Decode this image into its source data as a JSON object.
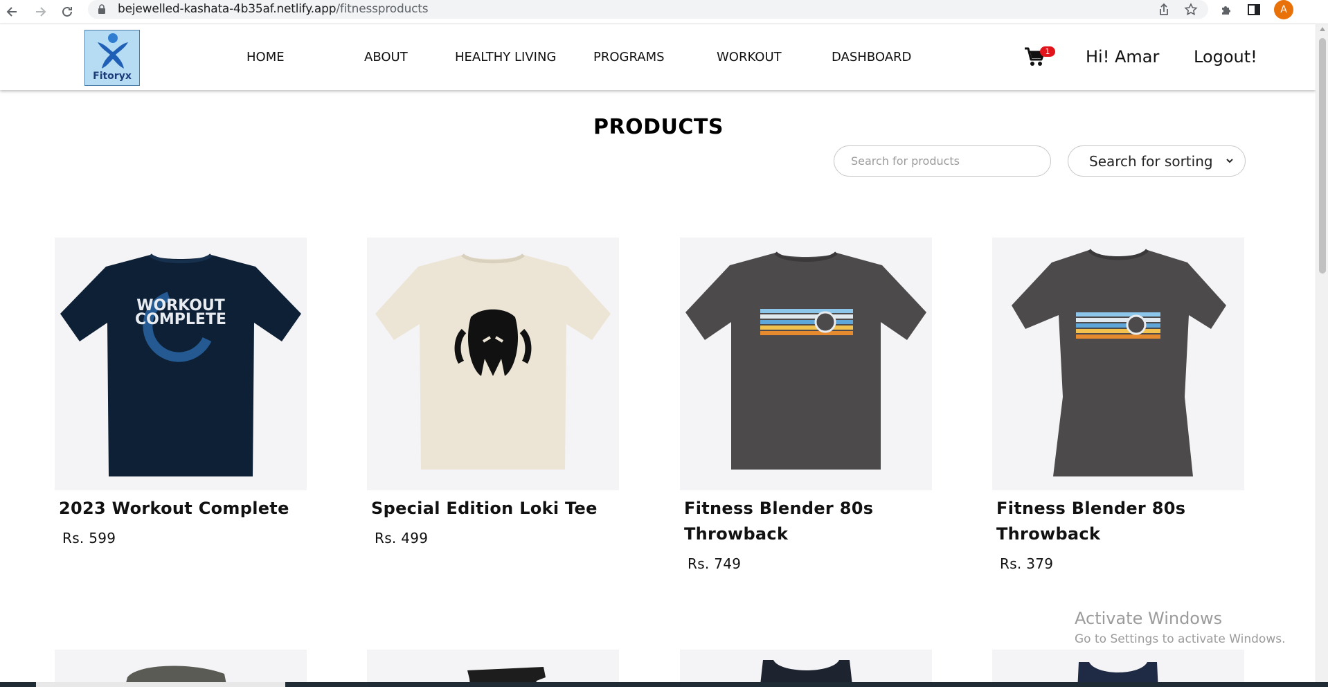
{
  "browser": {
    "url_host": "bejewelled-kashata-4b35af.netlify.app",
    "url_path": "/fitnessproducts",
    "profile_initial": "A"
  },
  "header": {
    "logo_text": "Fitoryx",
    "nav": [
      {
        "label": "HOME"
      },
      {
        "label": "ABOUT"
      },
      {
        "label": "HEALTHY LIVING"
      },
      {
        "label": "PROGRAMS"
      },
      {
        "label": "WORKOUT"
      },
      {
        "label": "DASHBOARD"
      }
    ],
    "cart_count": "1",
    "greeting": "Hi! Amar",
    "logout_label": "Logout!"
  },
  "products_page": {
    "title": "PRODUCTS",
    "search_placeholder": "Search for products",
    "sort_label": "Search for sorting"
  },
  "products": [
    {
      "name": "2023 Workout Complete",
      "price": "Rs. 599",
      "shirt_color": "#0d2036",
      "print_text_1": "WORKOUT",
      "print_text_2": "COMPLETE"
    },
    {
      "name": "Special Edition Loki Tee",
      "price": "Rs. 499",
      "shirt_color": "#ece5d6"
    },
    {
      "name": "Fitness Blender 80s Throwback",
      "price": "Rs. 749",
      "shirt_color": "#4d4a4c"
    },
    {
      "name": "Fitness Blender 80s Throwback",
      "price": "Rs. 379",
      "shirt_color": "#4d4a4c"
    }
  ],
  "watermark": {
    "title": "Activate Windows",
    "subtitle": "Go to Settings to activate Windows."
  }
}
